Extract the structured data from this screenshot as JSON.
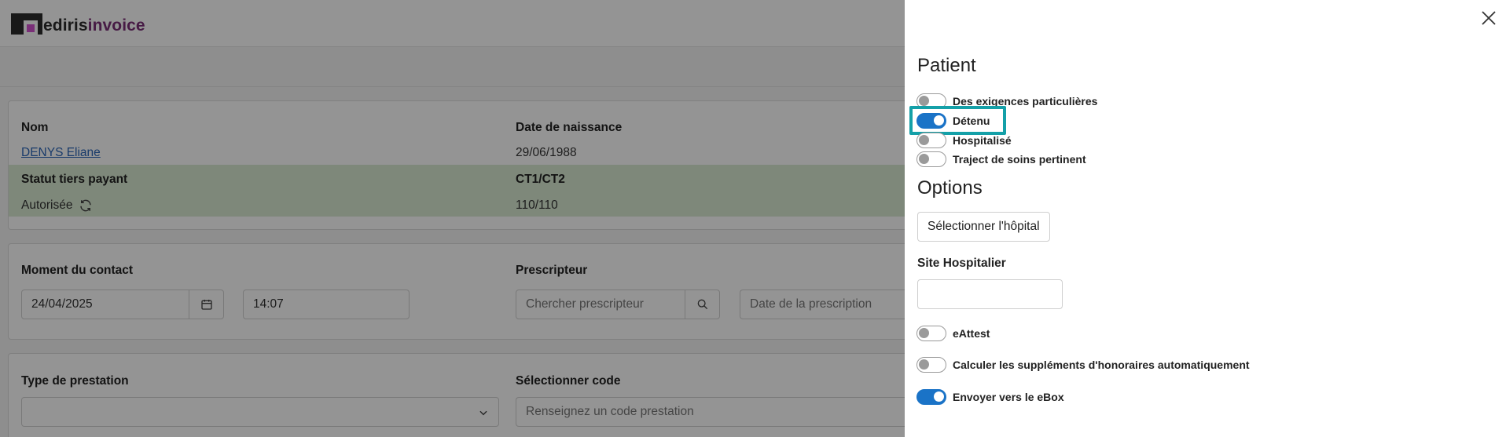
{
  "app": {
    "logo_part1": "ediris",
    "logo_part2": "invoice"
  },
  "patient_card": {
    "name_label": "Nom",
    "name_value": "DENYS Eliane",
    "dob_label": "Date de naissance",
    "dob_value": "29/06/1988",
    "status_label": "Statut tiers payant",
    "status_value": "Autorisée",
    "ct_label": "CT1/CT2",
    "ct_value": "110/110"
  },
  "contact_card": {
    "moment_label": "Moment du contact",
    "date_value": "24/04/2025",
    "time_value": "14:07",
    "prescriber_label": "Prescripteur",
    "prescriber_placeholder": "Chercher prescripteur",
    "prescription_date_placeholder": "Date de la prescription"
  },
  "service_card": {
    "type_label": "Type de prestation",
    "code_label": "Sélectionner code",
    "code_placeholder": "Renseignez un code prestation"
  },
  "panel": {
    "patient_title": "Patient",
    "toggles": [
      {
        "label": "Des exigences particulières",
        "on": false
      },
      {
        "label": "Détenu",
        "on": true
      },
      {
        "label": "Hospitalisé",
        "on": false
      },
      {
        "label": "Traject de soins pertinent",
        "on": false
      }
    ],
    "options_title": "Options",
    "select_hospital_button": "Sélectionner l'hôpital",
    "site_label": "Site Hospitalier",
    "site_value": "",
    "option_toggles": [
      {
        "label": "eAttest",
        "on": false
      },
      {
        "label": "Calculer les suppléments d'honoraires automatiquement",
        "on": false
      },
      {
        "label": "Envoyer vers le eBox",
        "on": true
      }
    ]
  },
  "colors": {
    "accent": "#1a73c7",
    "highlight": "#14a0a8",
    "brand": "#7a2f78",
    "status_band": "#d9ead3"
  }
}
